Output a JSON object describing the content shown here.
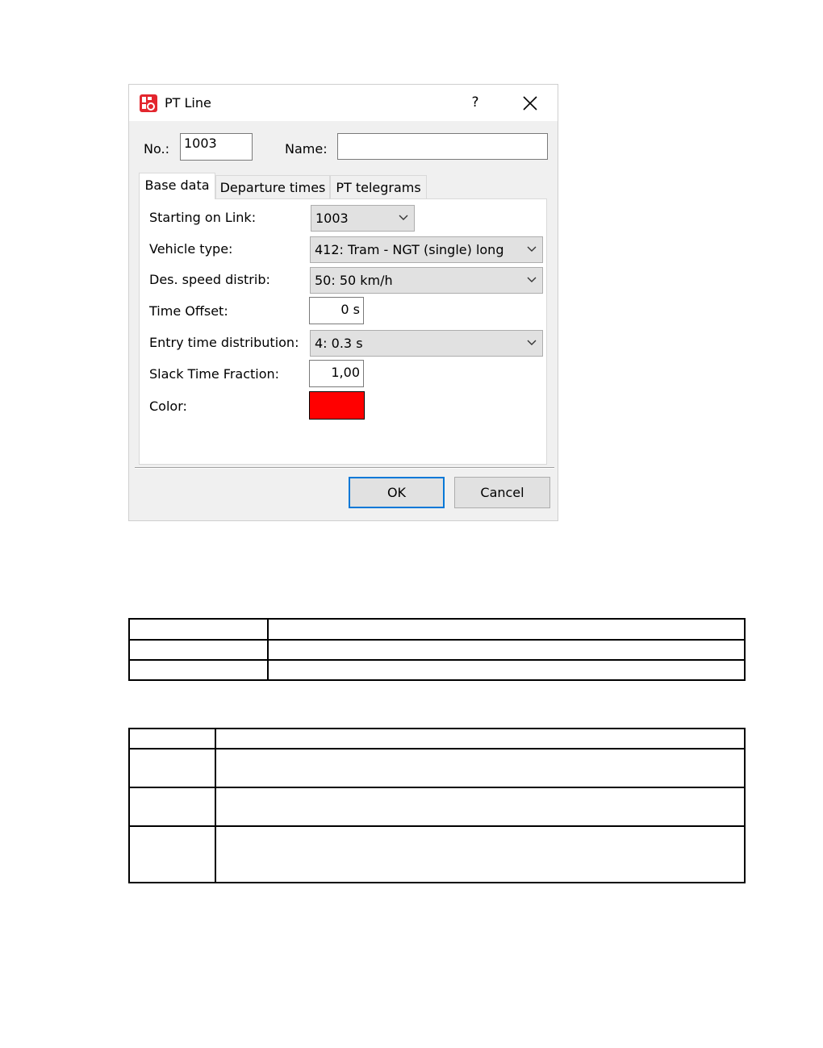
{
  "window": {
    "title": "PT Line",
    "help_label": "?",
    "icons": {
      "app": "vissim-app-icon",
      "close": "close-icon"
    }
  },
  "header": {
    "no_label": "No.:",
    "no_value": "1003",
    "name_label": "Name:",
    "name_value": ""
  },
  "tabs": [
    {
      "label": "Base data",
      "active": true
    },
    {
      "label": "Departure times",
      "active": false
    },
    {
      "label": "PT telegrams",
      "active": false
    }
  ],
  "base_data": {
    "starting_link_label": "Starting on Link:",
    "starting_link_value": "1003",
    "vehicle_type_label": "Vehicle type:",
    "vehicle_type_value": "412: Tram - NGT (single) long",
    "speed_distrib_label": "Des. speed distrib:",
    "speed_distrib_value": "50: 50 km/h",
    "time_offset_label": "Time Offset:",
    "time_offset_value": "0 s",
    "entry_time_label": "Entry time distribution:",
    "entry_time_value": "4: 0.3 s",
    "slack_time_label": "Slack Time Fraction:",
    "slack_time_value": "1,00",
    "color_label": "Color:",
    "color_value": "#ff0000"
  },
  "buttons": {
    "ok": "OK",
    "cancel": "Cancel"
  },
  "colors": {
    "accent": "#0078d7",
    "dialog_bg": "#f0f0f0",
    "app_icon": "#e3262e"
  }
}
